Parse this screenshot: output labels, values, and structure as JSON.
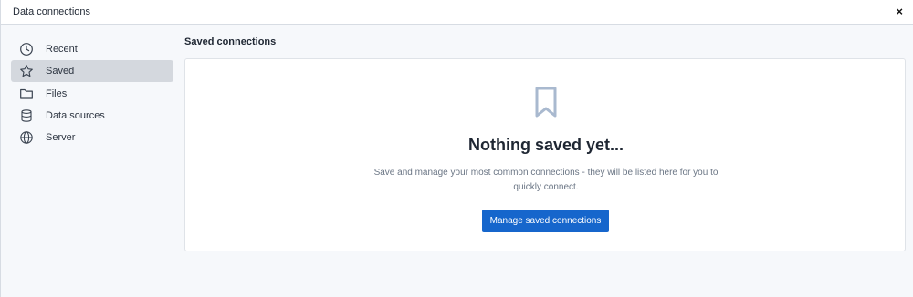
{
  "window": {
    "title": "Data connections",
    "close_label": "×"
  },
  "sidebar": {
    "items": [
      {
        "label": "Recent",
        "icon": "clock-icon",
        "active": false
      },
      {
        "label": "Saved",
        "icon": "star-icon",
        "active": true
      },
      {
        "label": "Files",
        "icon": "folder-icon",
        "active": false
      },
      {
        "label": "Data sources",
        "icon": "database-icon",
        "active": false
      },
      {
        "label": "Server",
        "icon": "globe-icon",
        "active": false
      }
    ]
  },
  "main": {
    "section_title": "Saved connections",
    "empty_state": {
      "icon": "bookmark-icon",
      "heading": "Nothing saved yet...",
      "description": "Save and manage your most common connections - they will be listed here for you to quickly connect.",
      "button_label": "Manage saved connections"
    }
  },
  "colors": {
    "accent": "#1666cc",
    "active_item_bg": "#d4d8de",
    "background": "#f6f8fb"
  }
}
